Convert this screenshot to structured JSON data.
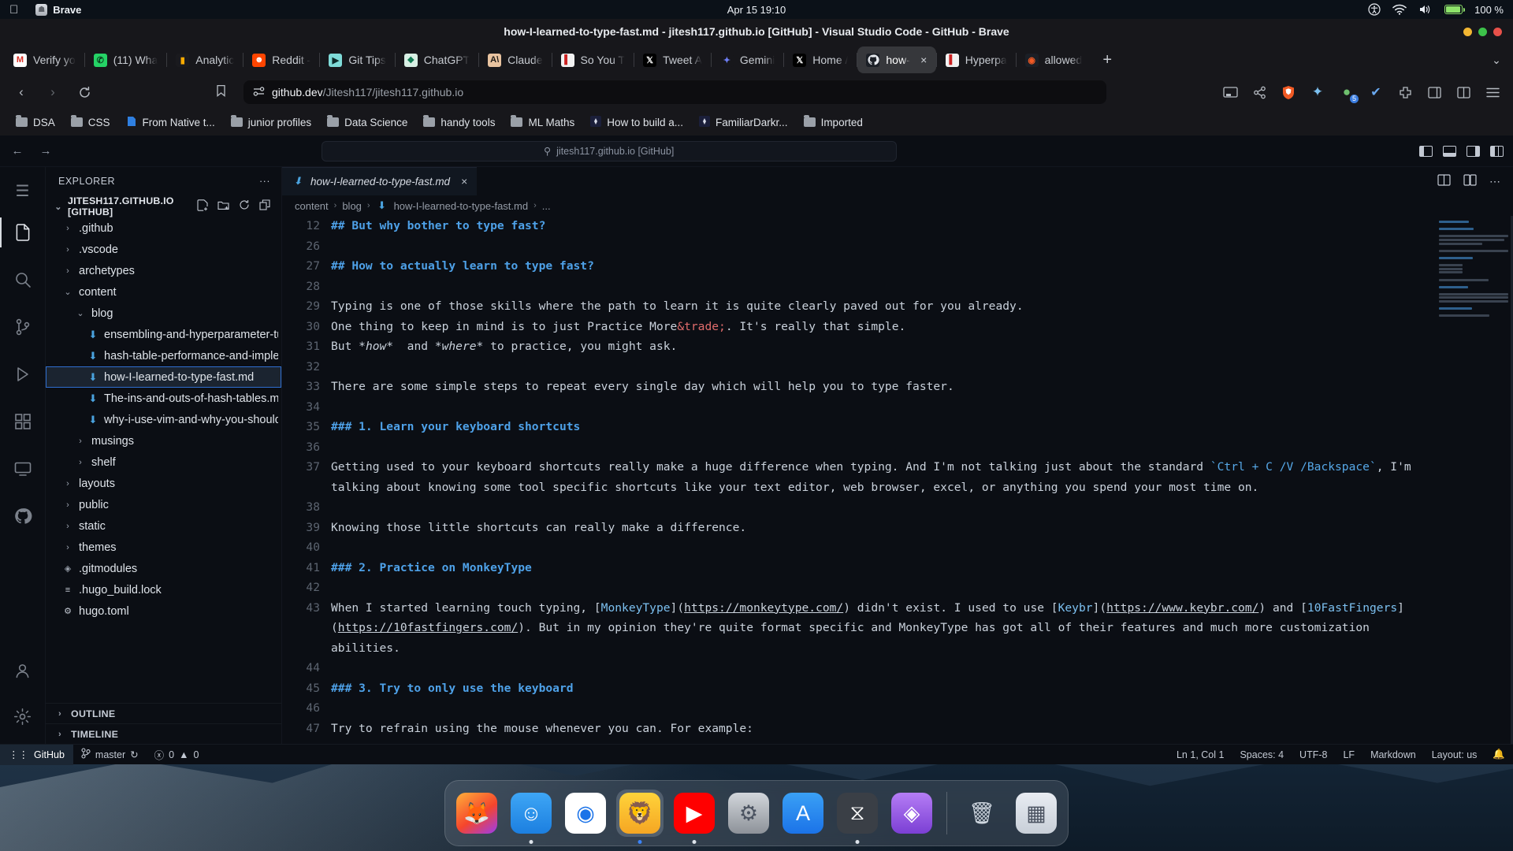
{
  "menubar": {
    "apple_icon": "apple-logo",
    "app_name": "Brave",
    "datetime": "Apr 15  19:10",
    "battery_percent": "100 %",
    "icons": [
      "accessibility-icon",
      "wifi-icon",
      "volume-icon",
      "battery-icon"
    ]
  },
  "window": {
    "title": "how-I-learned-to-type-fast.md - jitesh117.github.io [GitHub] - Visual Studio Code - GitHub - Brave"
  },
  "tabs": [
    {
      "label": "Verify yo",
      "favicon": "gmail-icon",
      "glyph": "M",
      "color": "#ffffff",
      "fg": "#d93025",
      "active": false
    },
    {
      "label": "(11) Wha",
      "favicon": "whatsapp-icon",
      "glyph": "✆",
      "color": "#25d366",
      "fg": "#0b3d1e",
      "active": false
    },
    {
      "label": "Analytic",
      "favicon": "analytics-icon",
      "glyph": "▮",
      "color": "#1a1a1e",
      "fg": "#f9ab00",
      "active": false
    },
    {
      "label": "Reddit -",
      "favicon": "reddit-icon",
      "glyph": "☻",
      "color": "#ff4500",
      "fg": "#ffffff",
      "active": false
    },
    {
      "label": "Git Tips",
      "favicon": "gittips-icon",
      "glyph": "▶",
      "color": "#7fdbd8",
      "fg": "#0d2b2a",
      "active": false
    },
    {
      "label": "ChatGPT",
      "favicon": "chatgpt-icon",
      "glyph": "❖",
      "color": "#d8efe4",
      "fg": "#0f7a52",
      "active": false
    },
    {
      "label": "Claude",
      "favicon": "claude-icon",
      "glyph": "A\\",
      "color": "#e8c3a0",
      "fg": "#1d1a17",
      "active": false
    },
    {
      "label": "So You T",
      "favicon": "book-icon",
      "glyph": "▌",
      "color": "#f2f2f2",
      "fg": "#cc2222",
      "active": false
    },
    {
      "label": "Tweet A",
      "favicon": "x-icon",
      "glyph": "𝕏",
      "color": "#000000",
      "fg": "#ffffff",
      "active": false
    },
    {
      "label": "Gemini",
      "favicon": "gemini-icon",
      "glyph": "✦",
      "color": "#17171b",
      "fg": "#6e7ef5",
      "active": false
    },
    {
      "label": "Home / ",
      "favicon": "x-icon",
      "glyph": "𝕏",
      "color": "#000000",
      "fg": "#ffffff",
      "active": false
    },
    {
      "label": "how-",
      "favicon": "github-icon",
      "glyph": "",
      "color": "#1b1f26",
      "fg": "#e6e9ee",
      "active": true,
      "close": "×"
    },
    {
      "label": "Hyperpa",
      "favicon": "book-icon",
      "glyph": "▌",
      "color": "#f2f2f2",
      "fg": "#cc2222",
      "active": false
    },
    {
      "label": "allowed",
      "favicon": "brave-icon",
      "glyph": "◉",
      "color": "#1b1f26",
      "fg": "#f15a24",
      "active": false
    }
  ],
  "tabstrip": {
    "new_tab": "+",
    "tab_list_chevron": "⌄"
  },
  "nav": {
    "back": "‹",
    "forward": "›",
    "reload": "⟳",
    "bookmark_icon": "bookmark-icon",
    "permission_icon": "site-settings-icon",
    "url_domain": "github.dev",
    "url_path": "/Jitesh117/jitesh117.github.io",
    "right_icons": [
      "cast-icon",
      "share-icon",
      "brave-shields-icon",
      "brave-leo-icon",
      "brave-rewards-icon",
      "wallet-icon",
      "extensions-icon",
      "sidebar-icon",
      "split-view-icon",
      "menu-icon"
    ],
    "leo_badge": "5"
  },
  "bookmarks": [
    {
      "label": "DSA",
      "icon": "folder-icon"
    },
    {
      "label": "CSS",
      "icon": "folder-icon"
    },
    {
      "label": "From Native t...",
      "icon": "page-icon"
    },
    {
      "label": "junior profiles",
      "icon": "folder-icon"
    },
    {
      "label": "Data Science",
      "icon": "folder-icon"
    },
    {
      "label": "handy tools",
      "icon": "folder-icon"
    },
    {
      "label": "ML Maths",
      "icon": "folder-icon"
    },
    {
      "label": "How to build a...",
      "icon": "site-icon"
    },
    {
      "label": "FamiliarDarkr...",
      "icon": "site-icon"
    },
    {
      "label": "Imported",
      "icon": "folder-icon"
    }
  ],
  "gh_topbar": {
    "back": "←",
    "forward": "→",
    "search_placeholder": "jitesh117.github.io [GitHub]",
    "search_icon": "search-icon",
    "layout_icons": [
      "toggle-primary-sidebar-icon",
      "toggle-panel-icon",
      "toggle-secondary-sidebar-icon",
      "customize-layout-icon"
    ]
  },
  "activitybar": {
    "menu_icon": "hamburger-menu-icon",
    "items": [
      {
        "name": "explorer",
        "glyph": "🗎",
        "active": true
      },
      {
        "name": "search",
        "glyph": "⌕",
        "active": false
      },
      {
        "name": "source-control",
        "glyph": "⑂",
        "active": false
      },
      {
        "name": "run-and-debug",
        "glyph": "▷",
        "active": false
      },
      {
        "name": "extensions",
        "glyph": "⊞",
        "active": false
      },
      {
        "name": "remote-explorer",
        "glyph": "🖵",
        "active": false
      },
      {
        "name": "github",
        "glyph": "◉",
        "active": false
      }
    ],
    "bottom": [
      {
        "name": "accounts",
        "glyph": "☺"
      },
      {
        "name": "settings",
        "glyph": "⚙"
      }
    ]
  },
  "explorer": {
    "title": "EXPLORER",
    "more_actions": "···",
    "root": "JITESH117.GITHUB.IO [GITHUB]",
    "root_chevron": "⌄",
    "actions": [
      "new-file-icon",
      "new-folder-icon",
      "refresh-icon",
      "collapse-all-icon"
    ],
    "tree": [
      {
        "label": ".github",
        "indent": 1,
        "type": "folder",
        "state": "collapsed"
      },
      {
        "label": ".vscode",
        "indent": 1,
        "type": "folder",
        "state": "collapsed"
      },
      {
        "label": "archetypes",
        "indent": 1,
        "type": "folder",
        "state": "collapsed"
      },
      {
        "label": "content",
        "indent": 1,
        "type": "folder",
        "state": "expanded"
      },
      {
        "label": "blog",
        "indent": 2,
        "type": "folder",
        "state": "expanded"
      },
      {
        "label": "ensembling-and-hyperparameter-tuning...",
        "indent": 3,
        "type": "md"
      },
      {
        "label": "hash-table-performance-and-implement...",
        "indent": 3,
        "type": "md"
      },
      {
        "label": "how-I-learned-to-type-fast.md",
        "indent": 3,
        "type": "md",
        "selected": true
      },
      {
        "label": "The-ins-and-outs-of-hash-tables.md",
        "indent": 3,
        "type": "md"
      },
      {
        "label": "why-i-use-vim-and-why-you-should-too.md",
        "indent": 3,
        "type": "md"
      },
      {
        "label": "musings",
        "indent": 2,
        "type": "folder",
        "state": "collapsed"
      },
      {
        "label": "shelf",
        "indent": 2,
        "type": "folder",
        "state": "collapsed"
      },
      {
        "label": "layouts",
        "indent": 1,
        "type": "folder",
        "state": "collapsed"
      },
      {
        "label": "public",
        "indent": 1,
        "type": "folder",
        "state": "collapsed"
      },
      {
        "label": "static",
        "indent": 1,
        "type": "folder",
        "state": "collapsed"
      },
      {
        "label": "themes",
        "indent": 1,
        "type": "folder",
        "state": "collapsed"
      },
      {
        "label": ".gitmodules",
        "indent": 1,
        "type": "git"
      },
      {
        "label": ".hugo_build.lock",
        "indent": 1,
        "type": "lock"
      },
      {
        "label": "hugo.toml",
        "indent": 1,
        "type": "toml"
      }
    ],
    "sections": [
      {
        "label": "OUTLINE",
        "chevron": "›"
      },
      {
        "label": "TIMELINE",
        "chevron": "›"
      }
    ]
  },
  "editor": {
    "tab_label": "how-I-learned-to-type-fast.md",
    "tab_close": "×",
    "tab_icon": "markdown-icon",
    "actions": [
      "split-editor-icon",
      "open-changes-icon",
      "more-actions-icon"
    ],
    "breadcrumb": [
      "content",
      "blog",
      "how-I-learned-to-type-fast.md",
      "..."
    ],
    "lines": [
      {
        "no": "12",
        "type": "heading",
        "text": "## But why bother to type fast?"
      },
      {
        "no": "26",
        "type": "blank",
        "text": ""
      },
      {
        "no": "27",
        "type": "heading",
        "text": "## How to actually learn to type fast?"
      },
      {
        "no": "28",
        "type": "blank",
        "text": ""
      },
      {
        "no": "29",
        "type": "text",
        "text": "Typing is one of those skills where the path to learn it is quite clearly paved out for you already."
      },
      {
        "no": "30",
        "type": "entity",
        "text": "One thing to keep in mind is to just Practice More&trade;. It's really that simple.",
        "pre": "One thing to keep in mind is to just Practice More",
        "entity": "&trade;",
        "post": ". It's really that simple."
      },
      {
        "no": "31",
        "type": "emphasis",
        "text": "But *how*  and *where* to practice, you might ask."
      },
      {
        "no": "32",
        "type": "blank",
        "text": ""
      },
      {
        "no": "33",
        "type": "text",
        "text": "There are some simple steps to repeat every single day which will help you to type faster."
      },
      {
        "no": "34",
        "type": "blank",
        "text": ""
      },
      {
        "no": "35",
        "type": "heading",
        "text": "### 1. Learn your keyboard shortcuts"
      },
      {
        "no": "36",
        "type": "blank",
        "text": ""
      },
      {
        "no": "37",
        "type": "code-inline",
        "pre": "Getting used to your keyboard shortcuts really make a huge difference when typing. And I'm not talking just about the standard ",
        "code": "`Ctrl + C /V /Backspace`",
        "post": ", I'm talking about knowing some tool specific shortcuts like your text editor, web browser, excel, or anything you spend your most time on."
      },
      {
        "no": "38",
        "type": "blank",
        "text": ""
      },
      {
        "no": "39",
        "type": "text",
        "text": "Knowing those little shortcuts can really make a difference."
      },
      {
        "no": "40",
        "type": "blank",
        "text": ""
      },
      {
        "no": "41",
        "type": "heading",
        "text": "### 2. Practice on MonkeyType"
      },
      {
        "no": "42",
        "type": "blank",
        "text": ""
      },
      {
        "no": "43",
        "type": "links",
        "text": "When I started learning touch typing, [MonkeyType](https://monkeytype.com/) didn't exist. I used to use [Keybr](https://www.keybr.com/) and [10FastFingers](https://10fastfingers.com/). But in my opinion they're quite format specific and MonkeyType has got all of their features and much more customization abilities."
      },
      {
        "no": "44",
        "type": "blank",
        "text": ""
      },
      {
        "no": "45",
        "type": "heading",
        "text": "### 3. Try to only use the keyboard"
      },
      {
        "no": "46",
        "type": "blank",
        "text": ""
      },
      {
        "no": "47",
        "type": "text",
        "text": "Try to refrain using the mouse whenever you can. For example:"
      }
    ]
  },
  "statusbar": {
    "remote": "GitHub",
    "remote_icon": "remote-indicator-icon",
    "branch": "master",
    "branch_icon": "source-control-icon",
    "sync_icon": "sync-icon",
    "errors": "0",
    "warnings": "0",
    "error_icon": "error-icon",
    "warning_icon": "warning-icon",
    "cursor": "Ln 1, Col 1",
    "indentation": "Spaces: 4",
    "encoding": "UTF-8",
    "eol": "LF",
    "language": "Markdown",
    "layout": "Layout: us",
    "bell_icon": "notifications-bell-icon"
  },
  "dock": [
    {
      "name": "firefox",
      "glyph": "🦊",
      "running": false,
      "highlight": false
    },
    {
      "name": "finder",
      "glyph": "☺",
      "running": true,
      "highlight": false
    },
    {
      "name": "chrome",
      "glyph": "◉",
      "running": false,
      "highlight": false
    },
    {
      "name": "brave",
      "glyph": "🦁",
      "running": true,
      "highlight": true,
      "dot_blue": true
    },
    {
      "name": "youtube-music",
      "glyph": "▶",
      "running": true,
      "highlight": false
    },
    {
      "name": "system-settings",
      "glyph": "⚙",
      "running": false,
      "highlight": false
    },
    {
      "name": "app-store",
      "glyph": "A",
      "running": false,
      "highlight": false
    },
    {
      "name": "vs-code",
      "glyph": "⧖",
      "running": true,
      "highlight": false
    },
    {
      "name": "obsidian",
      "glyph": "◈",
      "running": false,
      "highlight": false
    },
    {
      "name": "separator",
      "glyph": "",
      "running": false,
      "highlight": false
    },
    {
      "name": "trash",
      "glyph": "🗑",
      "running": false,
      "highlight": false
    },
    {
      "name": "launchpad",
      "glyph": "▦",
      "running": false,
      "highlight": false
    }
  ]
}
